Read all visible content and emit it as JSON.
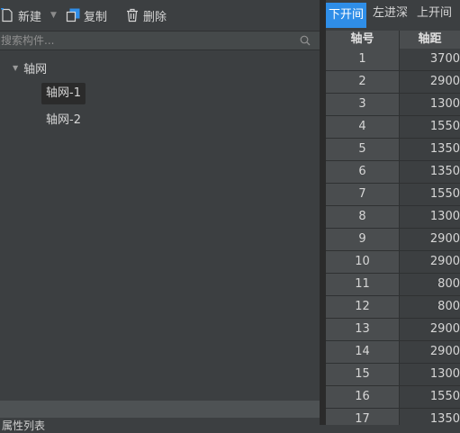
{
  "toolbar": {
    "new_label": "新建",
    "copy_label": "复制",
    "delete_label": "删除"
  },
  "search": {
    "placeholder": "搜索构件..."
  },
  "tree": {
    "root_label": "轴网",
    "items": [
      {
        "label": "轴网-1",
        "selected": true
      },
      {
        "label": "轴网-2",
        "selected": false
      }
    ]
  },
  "bottom_panel": {
    "label": "属性列表"
  },
  "right_panel": {
    "tabs": [
      {
        "label": "下开间",
        "active": true
      },
      {
        "label": "左进深",
        "active": false
      },
      {
        "label": "上开间",
        "active": false
      }
    ],
    "columns": [
      "轴号",
      "轴距"
    ],
    "rows": [
      [
        "1",
        "3700"
      ],
      [
        "2",
        "2900"
      ],
      [
        "3",
        "1300"
      ],
      [
        "4",
        "1550"
      ],
      [
        "5",
        "1350"
      ],
      [
        "6",
        "1350"
      ],
      [
        "7",
        "1550"
      ],
      [
        "8",
        "1300"
      ],
      [
        "9",
        "2900"
      ],
      [
        "10",
        "2900"
      ],
      [
        "11",
        "800"
      ],
      [
        "12",
        "800"
      ],
      [
        "13",
        "2900"
      ],
      [
        "14",
        "2900"
      ],
      [
        "15",
        "1300"
      ],
      [
        "16",
        "1550"
      ],
      [
        "17",
        "1350"
      ]
    ]
  },
  "colors": {
    "accent": "#2f8ee8",
    "background": "#3c3f41"
  }
}
